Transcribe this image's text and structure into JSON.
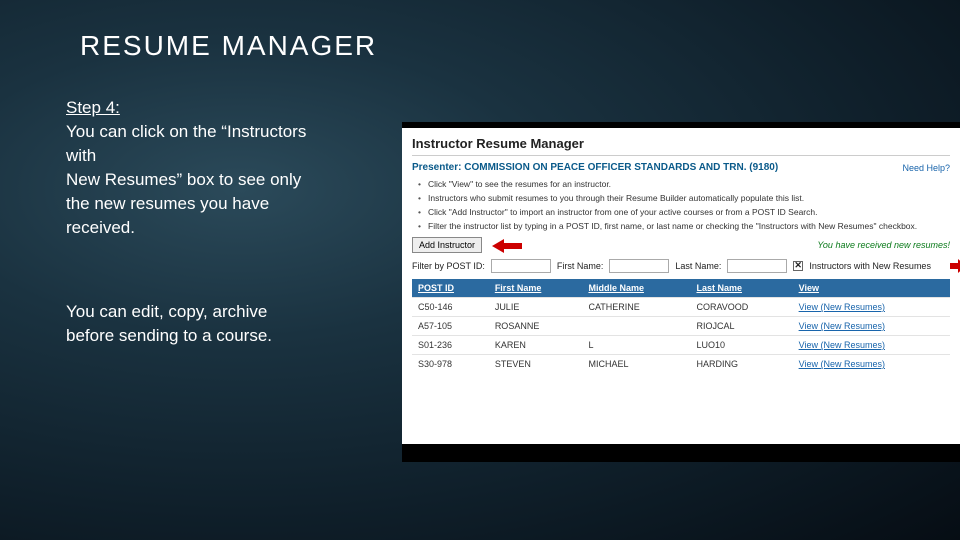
{
  "title": "RESUME MANAGER",
  "left": {
    "step": "Step 4:",
    "p1a": "You can click on the “Instructors with",
    "p1b": "New Resumes” box to see only the new resumes you have received.",
    "p2": "You can edit, copy, archive before sending to a course."
  },
  "panel": {
    "title": "Instructor Resume Manager",
    "presenter": "Presenter: COMMISSION ON PEACE OFFICER STANDARDS AND TRN. (9180)",
    "help": "Need Help?",
    "bullets": [
      "Click \"View\" to see the resumes for an instructor.",
      "Instructors who submit resumes to you through their Resume Builder automatically populate this list.",
      "Click \"Add Instructor\" to import an instructor from one of your active courses or from a POST ID Search.",
      "Filter the instructor list by typing in a POST ID, first name, or last name or checking the \"Instructors with New Resumes\" checkbox."
    ],
    "addBtn": "Add Instructor",
    "notice": "You have received new resumes!",
    "filter": {
      "label": "Filter by POST ID:",
      "fn": "First Name:",
      "ln": "Last Name:",
      "chk": "Instructors with New Resumes"
    },
    "headers": [
      "POST ID",
      "First Name",
      "Middle Name",
      "Last Name",
      "View"
    ],
    "rows": [
      [
        "C50-146",
        "JULIE",
        "CATHERINE",
        "CORAVOOD",
        "View (New Resumes)"
      ],
      [
        "A57-105",
        "ROSANNE",
        "",
        "RIOJCAL",
        "View (New Resumes)"
      ],
      [
        "S01-236",
        "KAREN",
        "L",
        "LUO10",
        "View (New Resumes)"
      ],
      [
        "S30-978",
        "STEVEN",
        "MICHAEL",
        "HARDING",
        "View (New Resumes)"
      ]
    ]
  }
}
